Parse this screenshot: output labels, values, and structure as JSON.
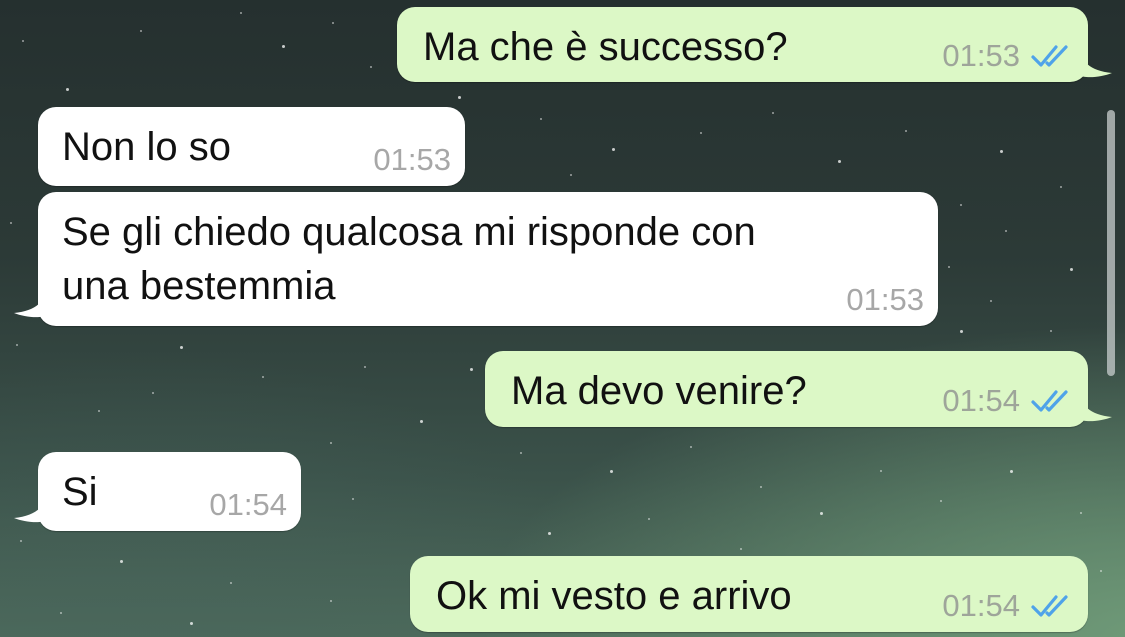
{
  "colors": {
    "outgoing_bubble": "#dcf8c6",
    "incoming_bubble": "#ffffff",
    "read_ticks": "#4fa3e9",
    "timestamp": "#9ea59a"
  },
  "messages": [
    {
      "direction": "outgoing",
      "text": "Ma che è successo?",
      "time": "01:53",
      "status_icon": "double-check-read-icon"
    },
    {
      "direction": "incoming",
      "text": "Non lo so",
      "time": "01:53"
    },
    {
      "direction": "incoming",
      "text": "Se gli chiedo qualcosa mi risponde con\nuna bestemmia",
      "time": "01:53"
    },
    {
      "direction": "outgoing",
      "text": "Ma devo venire?",
      "time": "01:54",
      "status_icon": "double-check-read-icon"
    },
    {
      "direction": "incoming",
      "text": "Si",
      "time": "01:54"
    },
    {
      "direction": "outgoing",
      "text": "Ok mi vesto e arrivo",
      "time": "01:54",
      "status_icon": "double-check-read-icon"
    }
  ]
}
